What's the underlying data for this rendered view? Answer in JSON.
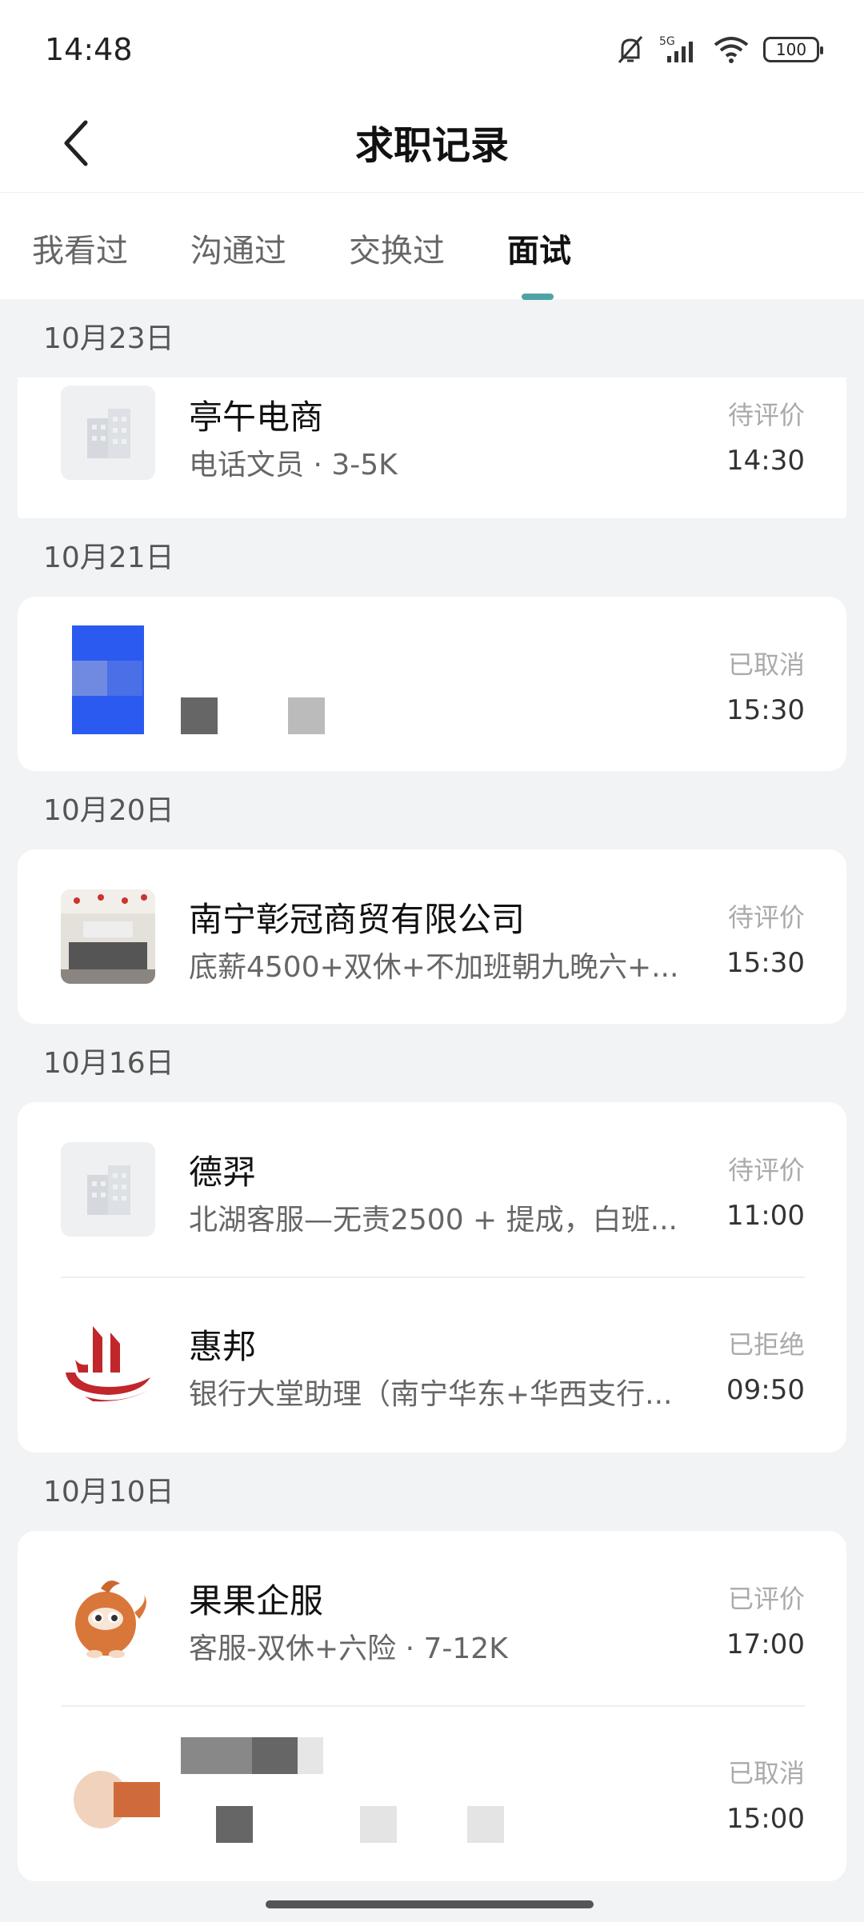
{
  "status_bar": {
    "time": "14:48",
    "network": "5G",
    "battery": "100"
  },
  "header": {
    "title": "求职记录"
  },
  "tabs": [
    {
      "label": "我看过",
      "active": false
    },
    {
      "label": "沟通过",
      "active": false
    },
    {
      "label": "交换过",
      "active": false
    },
    {
      "label": "面试",
      "active": true
    }
  ],
  "colors": {
    "accent": "#4fa3a5",
    "background": "#f2f3f5"
  },
  "groups": [
    {
      "date": "10月23日",
      "items": [
        {
          "company": "亭午电商",
          "job": "电话文员 · 3-5K",
          "status": "待评价",
          "time": "14:30",
          "logo": "building-icon"
        }
      ]
    },
    {
      "date": "10月21日",
      "items": [
        {
          "company": "",
          "job": "",
          "status": "已取消",
          "time": "15:30",
          "logo": "blurred-logo"
        }
      ]
    },
    {
      "date": "10月20日",
      "items": [
        {
          "company": "南宁彰冠商贸有限公司",
          "job": "底薪4500+双休+不加班朝九晚六+...",
          "status": "待评价",
          "time": "15:30",
          "logo": "office-photo"
        }
      ]
    },
    {
      "date": "10月16日",
      "items": [
        {
          "company": "德羿",
          "job": "北湖客服—无责2500 + 提成，白班...",
          "status": "待评价",
          "time": "11:00",
          "logo": "building-icon"
        },
        {
          "company": "惠邦",
          "job": "银行大堂助理（南宁华东+华西支行...",
          "status": "已拒绝",
          "time": "09:50",
          "logo": "huibang-logo"
        }
      ]
    },
    {
      "date": "10月10日",
      "items": [
        {
          "company": "果果企服",
          "job": "客服-双休+六险 · 7-12K",
          "status": "已评价",
          "time": "17:00",
          "logo": "mascot-logo"
        },
        {
          "company": "",
          "job": "",
          "status": "已取消",
          "time": "15:00",
          "logo": "blurred-logo"
        }
      ]
    }
  ]
}
